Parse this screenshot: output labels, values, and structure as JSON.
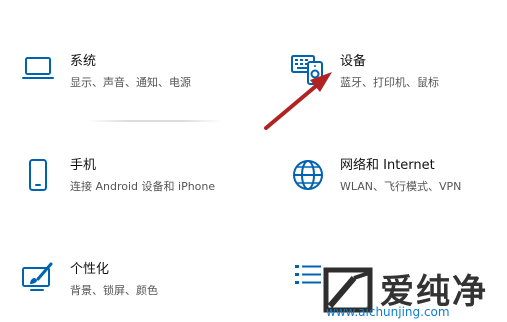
{
  "tiles": [
    {
      "name": "系统",
      "sub": "显示、声音、通知、电源"
    },
    {
      "name": "设备",
      "sub": "蓝牙、打印机、鼠标"
    },
    {
      "name": "手机",
      "sub": "连接 Android 设备和 iPhone"
    },
    {
      "name": "网络和 Internet",
      "sub": "WLAN、飞行模式、VPN"
    },
    {
      "name": "个性化",
      "sub": "背景、锁屏、颜色"
    }
  ],
  "watermark": {
    "main": "爱纯净",
    "url": "www.aichunjing.com"
  },
  "colors": {
    "accent": "#0063b1",
    "arrow": "#b22222"
  }
}
